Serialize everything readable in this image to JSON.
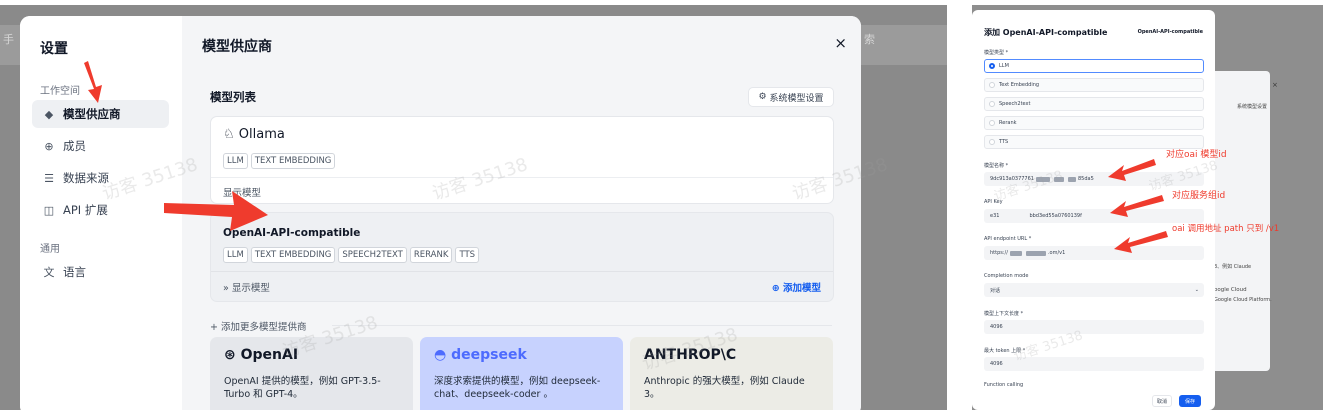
{
  "left": {
    "bg": {
      "hint_left": "手",
      "hint_right": "索"
    },
    "sidebar": {
      "title": "设置",
      "group_workspace": "工作空间",
      "group_general": "通用",
      "items": [
        {
          "label": "模型供应商",
          "icon": "cube-icon",
          "glyph": "◆"
        },
        {
          "label": "成员",
          "icon": "members-icon",
          "glyph": "⊕"
        },
        {
          "label": "数据来源",
          "icon": "database-icon",
          "glyph": "☰"
        },
        {
          "label": "API 扩展",
          "icon": "puzzle-icon",
          "glyph": "◫"
        },
        {
          "label": "语言",
          "icon": "translate-icon",
          "glyph": "文"
        }
      ]
    },
    "main": {
      "title": "模型供应商",
      "close": "×",
      "list_title": "模型列表",
      "sys_model_button": "系统模型设置",
      "providers": [
        {
          "name": "Ollama",
          "tags": [
            "LLM",
            "TEXT EMBEDDING"
          ],
          "show_models": "显示模型"
        },
        {
          "name": "OpenAI-API-compatible",
          "tags": [
            "LLM",
            "TEXT EMBEDDING",
            "SPEECH2TEXT",
            "RERANK",
            "TTS"
          ],
          "show_models": "显示模型",
          "add_model": "添加模型"
        }
      ],
      "more_providers": "+ 添加更多模型提供商",
      "cards": [
        {
          "logo": "OpenAI",
          "desc": "OpenAI 提供的模型，例如 GPT-3.5-Turbo 和 GPT-4。",
          "bg": "#e5e7eb"
        },
        {
          "logo": "deepseek",
          "desc": "深度求索提供的模型，例如 deepseek-chat、deepseek-coder 。",
          "bg": "#c7d2fe"
        },
        {
          "logo": "ANTHROP\\C",
          "desc": "Anthropic 的强大模型，例如 Claude 3。",
          "bg": "#ecece6"
        }
      ]
    },
    "watermark": "访客 35138"
  },
  "right": {
    "dialog": {
      "title": "添加 OpenAI-API-compatible",
      "brand": "OpenAI-API-compatible",
      "model_type_label": "模型类型 *",
      "model_types": [
        "LLM",
        "Text Embedding",
        "Speech2text",
        "Rerank",
        "TTS"
      ],
      "model_name_label": "模型名称 *",
      "model_name_value_a": "9dc913a0377761",
      "model_name_value_b": "85da5",
      "api_key_label": "API Key",
      "api_key_value_a": "e31",
      "api_key_value_b": "bbd3ed55a0760139f",
      "endpoint_label": "API endpoint URL *",
      "endpoint_value_a": "https://",
      "endpoint_value_b": ".om/v1",
      "completion_label": "Completion mode",
      "completion_value": "对话",
      "context_label": "模型上下文长度 *",
      "context_value": "4096",
      "max_token_label": "最大 token 上限 *",
      "max_token_value": "4096",
      "function_label": "Function calling",
      "cancel": "取消",
      "save": "保存"
    },
    "bg_panel": {
      "sys": "系统模型设置",
      "cloud": "oogle Cloud",
      "cloud_desc": "Google Cloud Platform.",
      "claude": "3、例如 Claude"
    },
    "annotations": {
      "model_id": "对应oai 模型id",
      "service_id": "对应服务组id",
      "path": "oai 调用地址 path 只到 /v1"
    },
    "watermark": "访客 35138"
  },
  "colors": {
    "accent": "#155eef",
    "arrow": "#ef3b2d"
  }
}
